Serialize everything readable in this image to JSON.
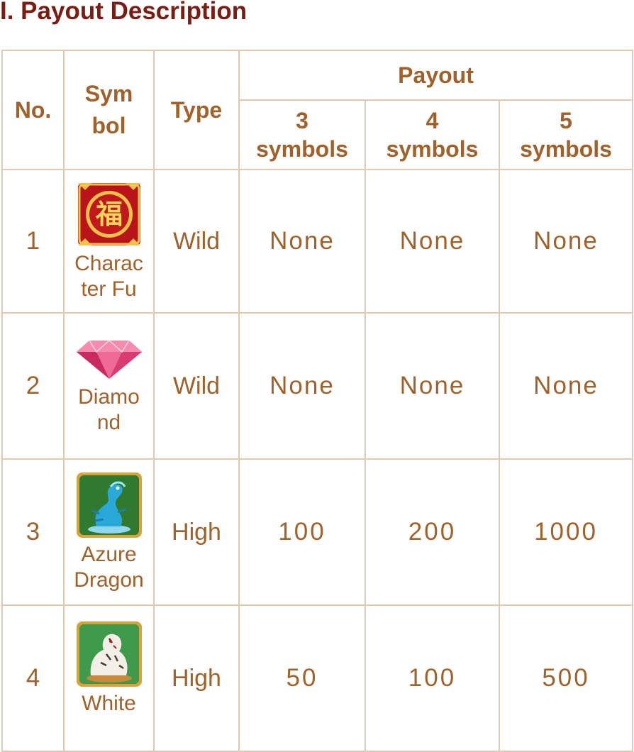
{
  "title": "I. Payout Description",
  "headers": {
    "no": "No.",
    "symbol_line1": "Sym",
    "symbol_line2": "bol",
    "type": "Type",
    "payout": "Payout",
    "col3_num": "3",
    "col3_label": "symbols",
    "col4_num": "4",
    "col4_label": "symbols",
    "col5_num": "5",
    "col5_label": "symbols"
  },
  "rows": [
    {
      "no": "1",
      "icon": "character-fu-icon",
      "name_line1": "Charac",
      "name_line2": "ter Fu",
      "type": "Wild",
      "p3": "None",
      "p4": "None",
      "p5": "None"
    },
    {
      "no": "2",
      "icon": "diamond-icon",
      "name_line1": "Diamo",
      "name_line2": "nd",
      "type": "Wild",
      "p3": "None",
      "p4": "None",
      "p5": "None"
    },
    {
      "no": "3",
      "icon": "azure-dragon-icon",
      "name_line1": "Azure",
      "name_line2": "Dragon",
      "type": "High",
      "p3": "100",
      "p4": "200",
      "p5": "1000"
    },
    {
      "no": "4",
      "icon": "white-tiger-icon",
      "name_line1": "White",
      "name_line2": "",
      "type": "High",
      "p3": "50",
      "p4": "100",
      "p5": "500"
    }
  ],
  "colors": {
    "title": "#7a1c12",
    "text": "#a0612a",
    "border": "#e3c9b0"
  }
}
